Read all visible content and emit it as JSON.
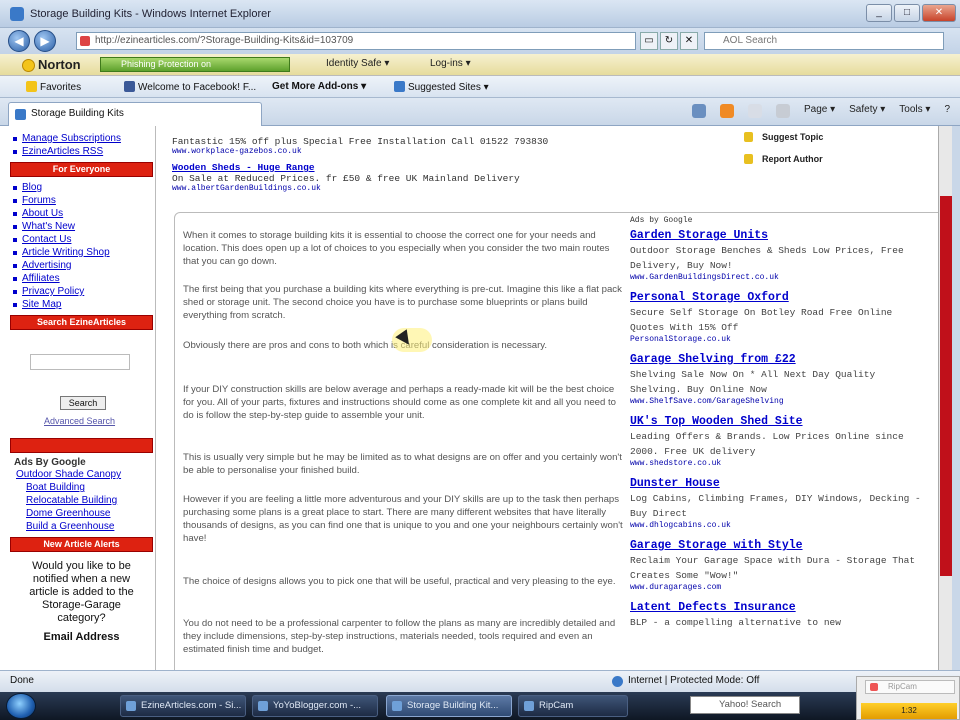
{
  "window": {
    "title": "Storage Building Kits - Windows Internet Explorer",
    "btn_min": "_",
    "btn_max": "□",
    "btn_close": "✕"
  },
  "address": {
    "url": "http://ezinearticles.com/?Storage-Building-Kits&id=103709",
    "search_placeholder": "AOL Search"
  },
  "norton": {
    "logo": "Norton",
    "phishing": "Phishing Protection on",
    "identity": "Identity Safe ▾",
    "logins": "Log-ins ▾"
  },
  "favorites": {
    "label": "Favorites",
    "items": [
      "Welcome to Facebook! F...",
      "Get More Add-ons ▾",
      "Suggested Sites ▾"
    ]
  },
  "tab": {
    "label": "Storage Building Kits"
  },
  "commands": {
    "page": "Page ▾",
    "safety": "Safety ▾",
    "tools": "Tools ▾",
    "help": "?"
  },
  "left": {
    "top_links": [
      "Manage Subscriptions",
      "EzineArticles RSS"
    ],
    "everyone_header": "For Everyone",
    "everyone_links": [
      "Blog",
      "Forums",
      "About Us",
      "What's New",
      "Contact Us",
      "Article Writing Shop",
      "Advertising",
      "Affiliates",
      "Privacy Policy",
      "Site Map"
    ],
    "search_header": "Search EzineArticles",
    "search_button": "Search",
    "advanced_search": "Advanced Search",
    "ads_header": "Ads By Google",
    "ads": [
      "Outdoor Shade Canopy",
      "Boat Building",
      "Relocatable Building",
      "Dome Greenhouse",
      "Build a Greenhouse"
    ],
    "alerts_header": "New Article Alerts",
    "alert_text": "Would you like to be notified when a new article is added to the Storage-Garage category?",
    "email_label": "Email Address"
  },
  "top_ads": [
    {
      "text": "Fantastic 15% off plus Special Free Installation Call 01522 793830",
      "url": "www.workplace-gazebos.co.uk"
    },
    {
      "title": "Wooden Sheds - Huge Range",
      "text": "On Sale at Reduced Prices. fr £50 & free UK Mainland Delivery",
      "url": "www.albertGardenBuildings.co.uk"
    }
  ],
  "tools": {
    "suggest": "Suggest Topic",
    "report": "Report Author"
  },
  "article": {
    "paragraphs": [
      "When it comes to storage building kits it is essential to choose the correct one for your needs and location. This does open up a lot of choices to you especially when you consider the two main routes that you can go down.",
      "The first being that you purchase a building kits where everything is pre-cut. Imagine this like a flat pack shed or storage unit. The second choice you have is to purchase some blueprints or plans build everything from scratch.",
      "Obviously there are pros and cons to both which is careful consideration is necessary.",
      "If your DIY construction skills are below average and perhaps a ready-made kit will be the best choice for you. All of your parts, fixtures and instructions should come as one complete kit and all you need to do is follow the step-by-step guide to assemble your unit.",
      "This is usually very simple but he may be limited as to what designs are on offer and you certainly won't be able to personalise your finished build.",
      "However if you are feeling a little more adventurous and your DIY skills are up to the task then perhaps purchasing some plans is a great place to start. There are many different websites that have literally thousands of designs, as you can find one that is unique to you and one your neighbours certainly won't have!",
      "The choice of designs allows you to pick one that will be useful, practical and very pleasing to the eye.",
      "You do not need to be a professional carpenter to follow the plans as many are incredibly detailed and they include dimensions, step-by-step instructions, materials needed, tools required and even an estimated finish time and budget."
    ]
  },
  "right_ads": {
    "header": "Ads by Google",
    "items": [
      {
        "title": "Garden Storage Units",
        "desc": "Outdoor Storage Benches & Sheds Low Prices, Free Delivery, Buy Now!",
        "url": "www.GardenBuildingsDirect.co.uk"
      },
      {
        "title": "Personal Storage Oxford",
        "desc": "Secure Self Storage On Botley Road Free Online Quotes With 15% Off",
        "url": "PersonalStorage.co.uk"
      },
      {
        "title": "Garage Shelving from £22",
        "desc": "Shelving Sale Now On * All Next Day Quality Shelving. Buy Online Now",
        "url": "www.ShelfSave.com/GarageShelving"
      },
      {
        "title": "UK's Top Wooden Shed Site",
        "desc": "Leading Offers & Brands. Low Prices Online since 2000. Free UK delivery",
        "url": "www.shedstore.co.uk"
      },
      {
        "title": "Dunster House",
        "desc": "Log Cabins, Climbing Frames, DIY Windows, Decking - Buy Direct",
        "url": "www.dhlogcabins.co.uk"
      },
      {
        "title": "Garage Storage with Style",
        "desc": "Reclaim Your Garage Space with Dura - Storage That Creates Some \"Wow!\"",
        "url": "www.duragarages.com"
      },
      {
        "title": "Latent Defects Insurance",
        "desc": "BLP - a compelling alternative to new",
        "url": ""
      }
    ]
  },
  "status": {
    "left": "Done",
    "zone": "Internet | Protected Mode: Off"
  },
  "taskbar": {
    "items": [
      "EzineArticles.com - Si...",
      "YoYoBlogger.com -...",
      "Storage Building Kit...",
      "RipCam"
    ],
    "search": "Yahoo! Search"
  },
  "tray": {
    "popup": "RipCam",
    "clock": "1:32"
  }
}
